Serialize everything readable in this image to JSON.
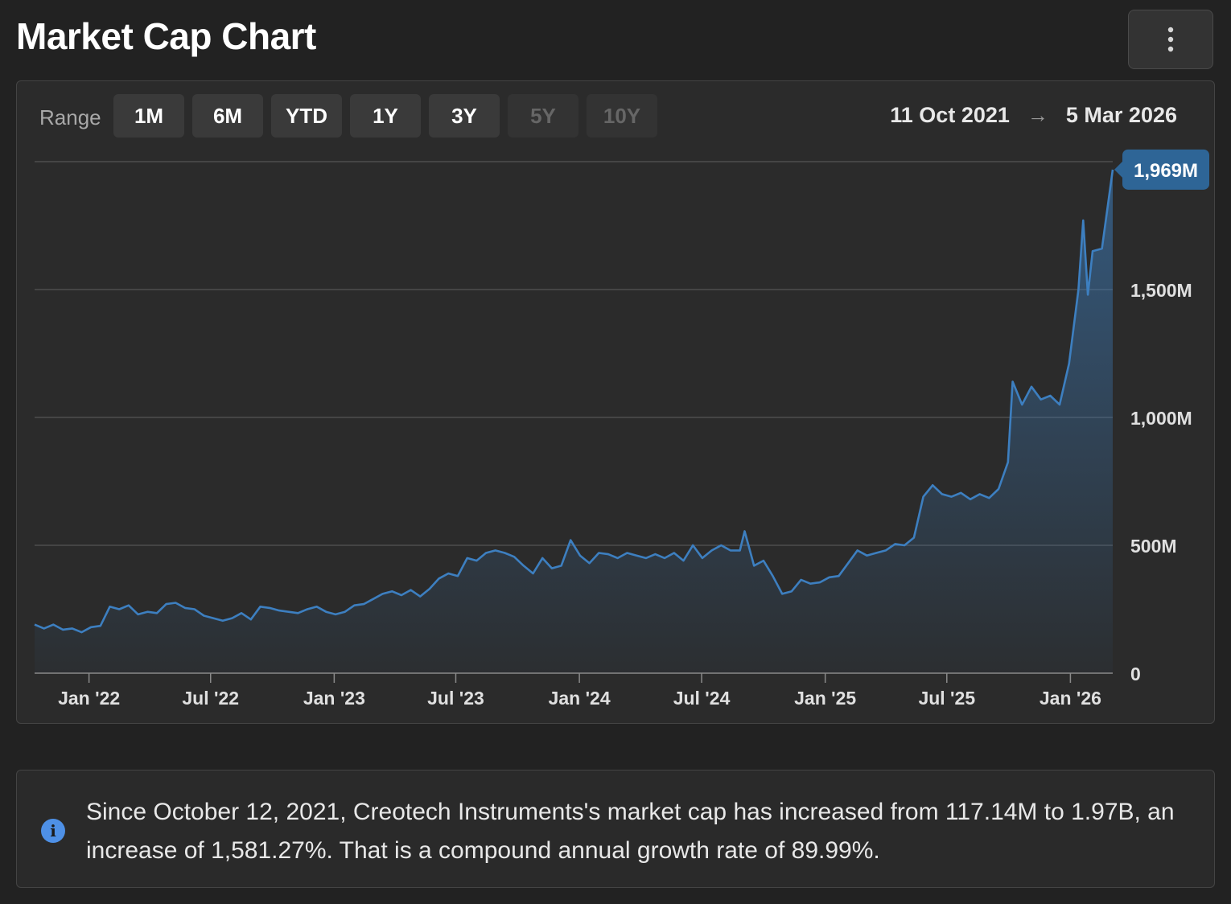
{
  "header": {
    "title": "Market Cap Chart",
    "menu_icon": "more-vertical-icon"
  },
  "range": {
    "label": "Range",
    "buttons": [
      {
        "label": "1M",
        "enabled": true
      },
      {
        "label": "6M",
        "enabled": true
      },
      {
        "label": "YTD",
        "enabled": true
      },
      {
        "label": "1Y",
        "enabled": true
      },
      {
        "label": "3Y",
        "enabled": true
      },
      {
        "label": "5Y",
        "enabled": false
      },
      {
        "label": "10Y",
        "enabled": false
      }
    ],
    "start_date": "11 Oct 2021",
    "end_date": "5 Mar 2026"
  },
  "chart_data": {
    "type": "area",
    "color": "#3d7fc0",
    "last_value_label": "1,969M",
    "ylim": [
      0,
      2000
    ],
    "y_ticks": [
      {
        "value": 0,
        "label": "0"
      },
      {
        "value": 500,
        "label": "500M"
      },
      {
        "value": 1000,
        "label": "1,000M"
      },
      {
        "value": 1500,
        "label": "1,500M"
      }
    ],
    "x_ticks": [
      {
        "date": "2022-01-01",
        "label": "Jan '22"
      },
      {
        "date": "2022-07-01",
        "label": "Jul '22"
      },
      {
        "date": "2023-01-01",
        "label": "Jan '23"
      },
      {
        "date": "2023-07-01",
        "label": "Jul '23"
      },
      {
        "date": "2024-01-01",
        "label": "Jan '24"
      },
      {
        "date": "2024-07-01",
        "label": "Jul '24"
      },
      {
        "date": "2025-01-01",
        "label": "Jan '25"
      },
      {
        "date": "2025-07-01",
        "label": "Jul '25"
      },
      {
        "date": "2026-01-01",
        "label": "Jan '26"
      }
    ],
    "series": [
      {
        "values": [
          [
            "2021-10-12",
            190
          ],
          [
            "2021-10-26",
            175
          ],
          [
            "2021-11-09",
            190
          ],
          [
            "2021-11-23",
            170
          ],
          [
            "2021-12-07",
            175
          ],
          [
            "2021-12-21",
            160
          ],
          [
            "2022-01-04",
            180
          ],
          [
            "2022-01-18",
            185
          ],
          [
            "2022-02-01",
            260
          ],
          [
            "2022-02-15",
            250
          ],
          [
            "2022-03-01",
            265
          ],
          [
            "2022-03-15",
            230
          ],
          [
            "2022-03-29",
            240
          ],
          [
            "2022-04-12",
            235
          ],
          [
            "2022-04-26",
            270
          ],
          [
            "2022-05-10",
            275
          ],
          [
            "2022-05-24",
            255
          ],
          [
            "2022-06-07",
            250
          ],
          [
            "2022-06-21",
            225
          ],
          [
            "2022-07-05",
            215
          ],
          [
            "2022-07-19",
            205
          ],
          [
            "2022-08-02",
            215
          ],
          [
            "2022-08-16",
            235
          ],
          [
            "2022-08-30",
            210
          ],
          [
            "2022-09-13",
            260
          ],
          [
            "2022-09-27",
            255
          ],
          [
            "2022-10-11",
            245
          ],
          [
            "2022-10-25",
            240
          ],
          [
            "2022-11-08",
            235
          ],
          [
            "2022-11-22",
            250
          ],
          [
            "2022-12-06",
            260
          ],
          [
            "2022-12-20",
            240
          ],
          [
            "2023-01-03",
            230
          ],
          [
            "2023-01-17",
            240
          ],
          [
            "2023-01-31",
            265
          ],
          [
            "2023-02-14",
            270
          ],
          [
            "2023-02-28",
            290
          ],
          [
            "2023-03-14",
            310
          ],
          [
            "2023-03-28",
            320
          ],
          [
            "2023-04-11",
            305
          ],
          [
            "2023-04-25",
            325
          ],
          [
            "2023-05-09",
            300
          ],
          [
            "2023-05-23",
            330
          ],
          [
            "2023-06-06",
            370
          ],
          [
            "2023-06-20",
            390
          ],
          [
            "2023-07-04",
            380
          ],
          [
            "2023-07-18",
            450
          ],
          [
            "2023-08-01",
            440
          ],
          [
            "2023-08-15",
            470
          ],
          [
            "2023-08-29",
            480
          ],
          [
            "2023-09-12",
            470
          ],
          [
            "2023-09-26",
            455
          ],
          [
            "2023-10-10",
            420
          ],
          [
            "2023-10-24",
            390
          ],
          [
            "2023-11-07",
            450
          ],
          [
            "2023-11-21",
            410
          ],
          [
            "2023-12-05",
            420
          ],
          [
            "2023-12-19",
            520
          ],
          [
            "2024-01-02",
            460
          ],
          [
            "2024-01-16",
            430
          ],
          [
            "2024-01-30",
            470
          ],
          [
            "2024-02-13",
            465
          ],
          [
            "2024-02-27",
            450
          ],
          [
            "2024-03-12",
            470
          ],
          [
            "2024-03-26",
            460
          ],
          [
            "2024-04-09",
            450
          ],
          [
            "2024-04-23",
            465
          ],
          [
            "2024-05-07",
            450
          ],
          [
            "2024-05-21",
            470
          ],
          [
            "2024-06-04",
            440
          ],
          [
            "2024-06-18",
            500
          ],
          [
            "2024-07-02",
            450
          ],
          [
            "2024-07-16",
            480
          ],
          [
            "2024-07-30",
            500
          ],
          [
            "2024-08-13",
            480
          ],
          [
            "2024-08-27",
            480
          ],
          [
            "2024-09-03",
            555
          ],
          [
            "2024-09-17",
            420
          ],
          [
            "2024-10-01",
            440
          ],
          [
            "2024-10-15",
            380
          ],
          [
            "2024-10-29",
            310
          ],
          [
            "2024-11-12",
            320
          ],
          [
            "2024-11-26",
            365
          ],
          [
            "2024-12-10",
            350
          ],
          [
            "2024-12-24",
            355
          ],
          [
            "2025-01-07",
            375
          ],
          [
            "2025-01-21",
            380
          ],
          [
            "2025-02-04",
            430
          ],
          [
            "2025-02-18",
            480
          ],
          [
            "2025-03-04",
            460
          ],
          [
            "2025-03-18",
            470
          ],
          [
            "2025-04-01",
            480
          ],
          [
            "2025-04-15",
            505
          ],
          [
            "2025-04-29",
            500
          ],
          [
            "2025-05-13",
            530
          ],
          [
            "2025-05-27",
            690
          ],
          [
            "2025-06-10",
            735
          ],
          [
            "2025-06-24",
            700
          ],
          [
            "2025-07-08",
            690
          ],
          [
            "2025-07-22",
            705
          ],
          [
            "2025-08-05",
            680
          ],
          [
            "2025-08-19",
            700
          ],
          [
            "2025-09-02",
            685
          ],
          [
            "2025-09-16",
            720
          ],
          [
            "2025-09-30",
            825
          ],
          [
            "2025-10-07",
            1140
          ],
          [
            "2025-10-21",
            1050
          ],
          [
            "2025-11-04",
            1120
          ],
          [
            "2025-11-18",
            1070
          ],
          [
            "2025-12-02",
            1085
          ],
          [
            "2025-12-16",
            1050
          ],
          [
            "2025-12-30",
            1210
          ],
          [
            "2026-01-13",
            1500
          ],
          [
            "2026-01-20",
            1770
          ],
          [
            "2026-01-27",
            1480
          ],
          [
            "2026-02-03",
            1650
          ],
          [
            "2026-02-17",
            1660
          ],
          [
            "2026-03-05",
            1969
          ]
        ]
      }
    ]
  },
  "info": {
    "icon": "info-icon",
    "text": "Since October 12, 2021, Creotech Instruments's market cap has increased from 117.14M to 1.97B, an increase of 1,581.27%. That is a compound annual growth rate of 89.99%."
  }
}
